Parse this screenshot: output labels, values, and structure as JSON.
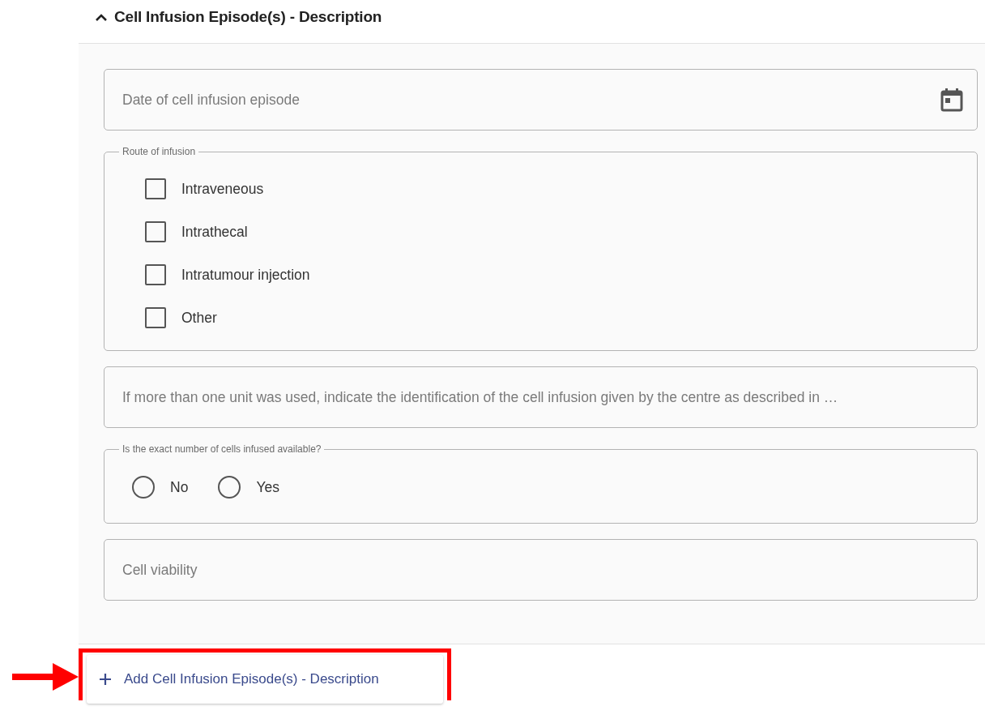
{
  "section": {
    "title": "Cell Infusion Episode(s) - Description",
    "expanded": true
  },
  "fields": [
    {
      "kind": "date",
      "placeholder": "Date of cell infusion episode"
    },
    {
      "kind": "checkboxes",
      "legend": "Route of infusion",
      "options": [
        {
          "label": "Intraveneous",
          "checked": false
        },
        {
          "label": "Intrathecal",
          "checked": false
        },
        {
          "label": "Intratumour injection",
          "checked": false
        },
        {
          "label": "Other",
          "checked": false
        }
      ]
    },
    {
      "kind": "text",
      "placeholder": "If more than one unit was used, indicate the identification of the cell infusion given by the centre as described in …"
    },
    {
      "kind": "radios",
      "legend": "Is the exact number of cells infused available?",
      "options": [
        {
          "label": "No",
          "selected": false
        },
        {
          "label": "Yes",
          "selected": false
        }
      ]
    },
    {
      "kind": "text",
      "placeholder": "Cell viability"
    }
  ],
  "add_button": {
    "label": "Add Cell Infusion Episode(s) - Description"
  }
}
